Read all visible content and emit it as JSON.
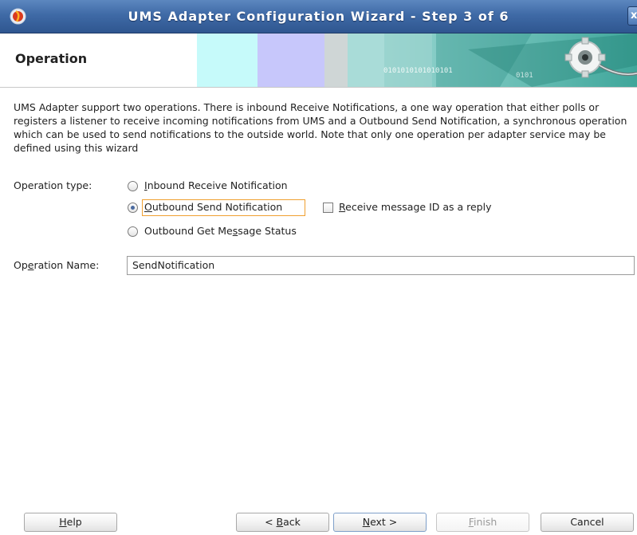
{
  "window": {
    "title": "UMS Adapter Configuration Wizard - Step 3 of 6",
    "close_glyph": "x",
    "app_icon": "oracle-jdeveloper-icon"
  },
  "banner": {
    "title": "Operation",
    "art_text_1": "0101010101010101",
    "art_text_2": "0101"
  },
  "description": "UMS Adapter support two operations. There is inbound Receive Notifications, a one way operation that either polls or registers a listener to receive incoming notifications from UMS and a Outbound Send Notification, a synchronous operation which can be used to send notifications to the outside world. Note that only one operation per adapter service may be defined using this wizard",
  "operation_type": {
    "label": "Operation type:",
    "options": [
      {
        "pre": "",
        "mn": "I",
        "post": "nbound Receive Notification",
        "selected": false
      },
      {
        "pre": "",
        "mn": "O",
        "post": "utbound Send Notification",
        "selected": true
      },
      {
        "pre": "Outbound Get Me",
        "mn": "s",
        "post": "sage Status",
        "selected": false
      }
    ],
    "reply_checkbox": {
      "mn": "R",
      "post": "eceive message ID as a reply",
      "checked": false
    }
  },
  "operation_name": {
    "label_pre": "Op",
    "label_mn": "e",
    "label_post": "ration Name:",
    "value": "SendNotification"
  },
  "buttons": {
    "help": {
      "mn": "H",
      "post": "elp"
    },
    "back": {
      "pre": "< ",
      "mn": "B",
      "post": "ack"
    },
    "next": {
      "mn": "N",
      "post": "ext >"
    },
    "finish": {
      "mn": "F",
      "post": "inish"
    },
    "cancel": "Cancel"
  },
  "colors": {
    "titlebar": "#3f6aa6",
    "focus": "#f0a030",
    "accent": "#4a6aa0"
  }
}
